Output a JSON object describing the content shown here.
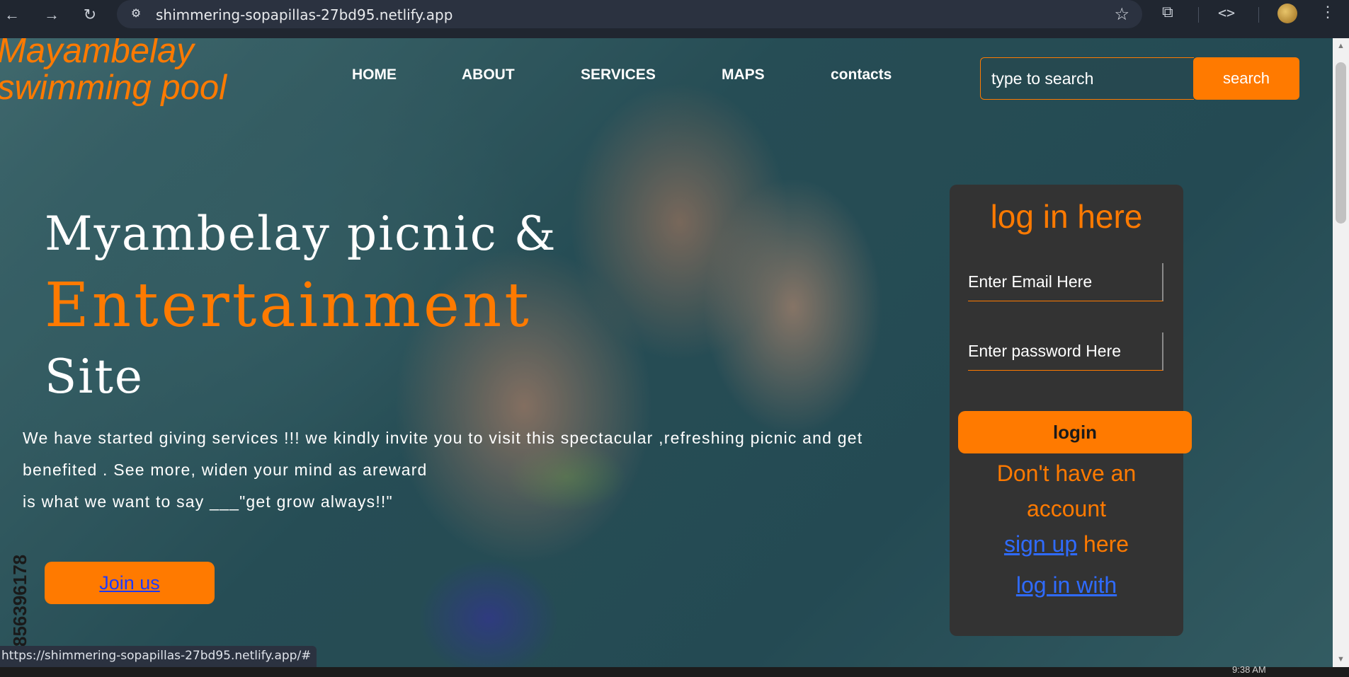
{
  "browser": {
    "url": "shimmering-sopapillas-27bd95.netlify.app",
    "status_url": "https://shimmering-sopapillas-27bd95.netlify.app/#",
    "clock": "9:38 AM"
  },
  "site": {
    "brand_line1": "Mayambelay",
    "brand_line2": "swimming pool",
    "nav": [
      "HOME",
      "ABOUT",
      "SERVICES",
      "MAPS",
      "contacts"
    ],
    "search": {
      "placeholder": "type to search",
      "button": "search"
    },
    "hero": {
      "line1": "Myambelay picnic &",
      "line2": "Entertainment",
      "line3": "Site",
      "body_line1": "We have started giving services !!! we kindly invite you to visit this spectacular ,refreshing picnic and get",
      "body_line2": "benefited . See more, widen your mind as areward",
      "body_line3": "is what we want to say ___\"get grow always!!\"",
      "join_button": "Join us",
      "side_number": "856396178"
    },
    "login": {
      "title": "log in here",
      "email_placeholder": "Enter Email Here",
      "password_placeholder": "Enter password Here",
      "button": "login",
      "no_account_line1": "Don't have an",
      "no_account_line2": "account",
      "signup_link": "sign up",
      "signup_suffix": " here",
      "login_with": "log in with"
    }
  },
  "colors": {
    "accent": "#ff7a00",
    "card": "#333333",
    "link": "#2f6bff"
  },
  "icons": [
    "back-icon",
    "forward-icon",
    "reload-icon",
    "site-settings-icon",
    "star-icon",
    "extensions-icon",
    "devtools-icon",
    "profile-avatar",
    "menu-icon"
  ]
}
